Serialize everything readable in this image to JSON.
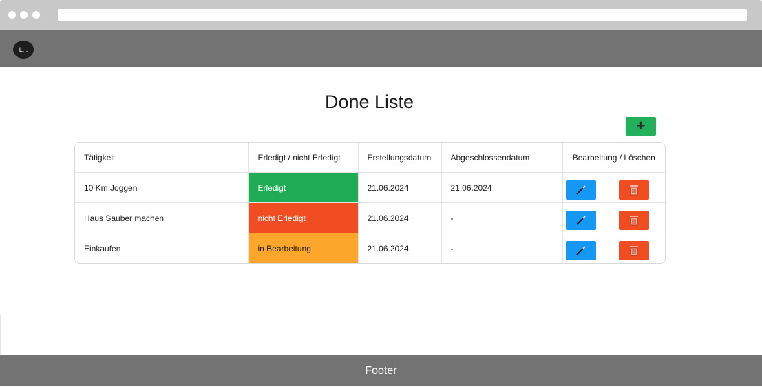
{
  "navbar": {
    "logo_label": "L..."
  },
  "page": {
    "title": "Done Liste",
    "add_button_icon": "plus-icon",
    "add_button_label": "+"
  },
  "table": {
    "columns": [
      "Tätigkeit",
      "Erledigt / nicht Erledigt",
      "Erstellungsdatum",
      "Abgeschlossendatum",
      "Bearbeitung / Löschen"
    ],
    "rows": [
      {
        "task": "10 Km Joggen",
        "status": "Erledigt",
        "status_color": "#1fac54",
        "created": "21.06.2024",
        "completed": "21.06.2024"
      },
      {
        "task": "Haus Sauber machen",
        "status": "nicht Erledigt",
        "status_color": "#f04d23",
        "created": "21.06.2024",
        "completed": "-"
      },
      {
        "task": "Einkaufen",
        "status": "in Bearbeitung",
        "status_color": "#fca72b",
        "created": "21.06.2024",
        "completed": "-"
      }
    ],
    "edit_icon": "pen-icon",
    "delete_icon": "trash-icon"
  },
  "colors": {
    "nav_bg": "#737373",
    "add_button": "#22b15a",
    "edit_button": "#1597f4",
    "delete_button": "#f04d23"
  },
  "footer": {
    "label": "Footer"
  }
}
